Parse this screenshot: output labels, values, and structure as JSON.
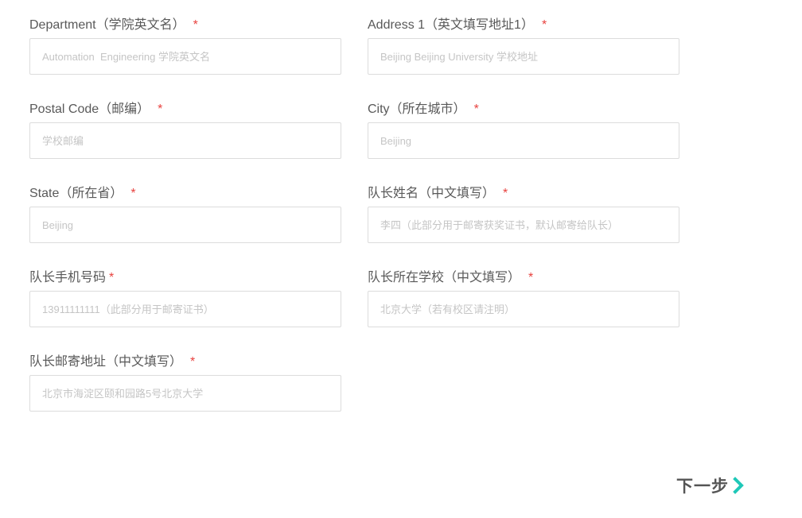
{
  "form": {
    "required_mark": "*",
    "fields": [
      {
        "label": "Department（学院英文名）",
        "value": "",
        "placeholder": "Automation  Engineering 学院英文名"
      },
      {
        "label": "Address 1（英文填写地址1）",
        "value": "",
        "placeholder": "Beijing Beijing University 学校地址"
      },
      {
        "label": "Postal Code（邮编）",
        "value": "",
        "placeholder": "学校邮编"
      },
      {
        "label": "City（所在城市）",
        "value": "",
        "placeholder": "Beijing"
      },
      {
        "label": "State（所在省）",
        "value": "",
        "placeholder": "Beijing"
      },
      {
        "label": "队长姓名（中文填写）",
        "value": "",
        "placeholder": "李四（此部分用于邮寄获奖证书，默认邮寄给队长）"
      },
      {
        "label": "队长手机号码",
        "value": "",
        "placeholder": "13911111111（此部分用于邮寄证书）"
      },
      {
        "label": "队长所在学校（中文填写）",
        "value": "",
        "placeholder": "北京大学（若有校区请注明）"
      },
      {
        "label": "队长邮寄地址（中文填写）",
        "value": "",
        "placeholder": "北京市海淀区颐和园路5号北京大学"
      }
    ]
  },
  "next": {
    "label": "下一步",
    "icon": "chevron-right-icon",
    "icon_color": "#1fc8b8"
  }
}
